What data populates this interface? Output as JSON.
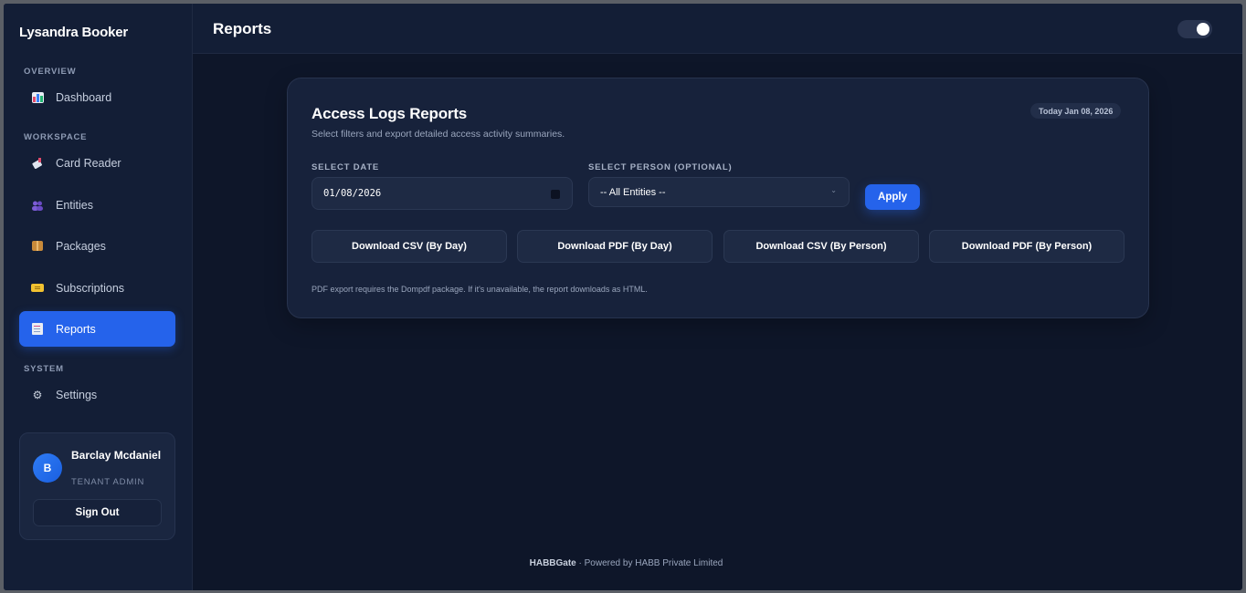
{
  "sidebar": {
    "brand": "Lysandra Booker",
    "sections": {
      "overview": "OVERVIEW",
      "workspace": "WORKSPACE",
      "system": "SYSTEM"
    },
    "items": [
      {
        "label": "Dashboard",
        "icon": "bar-chart-icon"
      },
      {
        "label": "Card Reader",
        "icon": "card-reader-icon"
      },
      {
        "label": "Entities",
        "icon": "people-icon"
      },
      {
        "label": "Packages",
        "icon": "package-icon"
      },
      {
        "label": "Subscriptions",
        "icon": "ticket-icon"
      },
      {
        "label": "Reports",
        "icon": "report-icon",
        "active": true
      },
      {
        "label": "Settings",
        "icon": "gear-icon"
      }
    ],
    "user": {
      "initial": "B",
      "name": "Barclay Mcdaniel",
      "role": "TENANT ADMIN",
      "signout_label": "Sign Out"
    }
  },
  "header": {
    "title": "Reports",
    "theme_toggle_on": true
  },
  "card": {
    "title": "Access Logs Reports",
    "subtitle": "Select filters and export detailed access activity summaries.",
    "date_badge": "Today Jan 08, 2026",
    "date_label": "SELECT DATE",
    "date_value": "01/08/2026",
    "person_label": "SELECT PERSON (OPTIONAL)",
    "person_value": "-- All Entities --",
    "apply_label": "Apply",
    "downloads": [
      "Download CSV (By Day)",
      "Download PDF (By Day)",
      "Download CSV (By Person)",
      "Download PDF (By Person)"
    ],
    "note": "PDF export requires the Dompdf package. If it's unavailable, the report downloads as HTML."
  },
  "footer": {
    "brand": "HABBGate",
    "text": " · Powered by HABB Private Limited"
  },
  "colors": {
    "accent": "#2563eb",
    "background": "#0e1629",
    "sidebar": "#131e36",
    "card": "#17223b"
  }
}
